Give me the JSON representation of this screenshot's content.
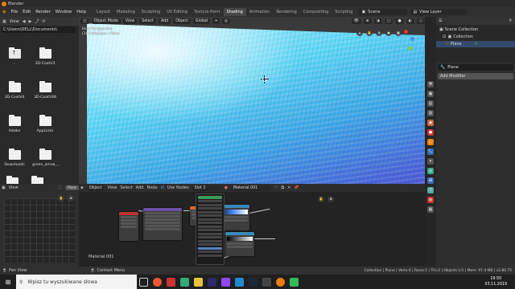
{
  "window": {
    "title": "Blender"
  },
  "menubar": {
    "menus": [
      "File",
      "Edit",
      "Render",
      "Window",
      "Help"
    ],
    "workspaces": [
      "Layout",
      "Modeling",
      "Sculpting",
      "UV Editing",
      "Texture Paint",
      "Shading",
      "Animation",
      "Rendering",
      "Compositing",
      "Scripting"
    ],
    "active_workspace": "Shading",
    "scene": "Scene",
    "view_layer": "View Layer"
  },
  "filebrowser": {
    "view_label": "View",
    "path": "C:\\Users\\DELL\\Documents\\",
    "items": [
      ".. ",
      "3D-CoatV3",
      "3D-CoatV4",
      "3D-CoatV48",
      "Adobe",
      "AppLinks",
      "Downloads",
      "green_arrow_..."
    ]
  },
  "viewport": {
    "mode": "Object Mode",
    "menus": [
      "View",
      "Select",
      "Add",
      "Object"
    ],
    "orientation": "Global",
    "info_line1": "User Perspective",
    "info_line2": "(1) Collection | Plane"
  },
  "outliner": {
    "rows": [
      "Scene Collection",
      "Collection",
      "Plane"
    ]
  },
  "properties": {
    "object": "Plane",
    "add_modifier": "Add Modifier"
  },
  "imageeditor": {
    "view_label": "View",
    "new_label": "New"
  },
  "nodeeditor": {
    "type": "Object",
    "menus": [
      "View",
      "Select",
      "Add",
      "Node"
    ],
    "use_nodes": "Use Nodes",
    "slot": "Slot 1",
    "material": "Material.001",
    "material_label": "Material.001"
  },
  "statusbar": {
    "pan": "Pan View",
    "context": "Context Menu",
    "stats": "Collection | Plane | Verts:4 | Faces:1 | Tris:2 | Objects:1/1 | Mem: 97.4 MB | v2.80.75"
  },
  "taskbar": {
    "search_placeholder": "Wpisz tu wyszukiwane słowa",
    "time": "19:50",
    "date": "03.11.2019"
  },
  "colors": {
    "accent": "#e87d0d",
    "water_light": "#bff6ff",
    "water_deep": "#4a64d8"
  }
}
